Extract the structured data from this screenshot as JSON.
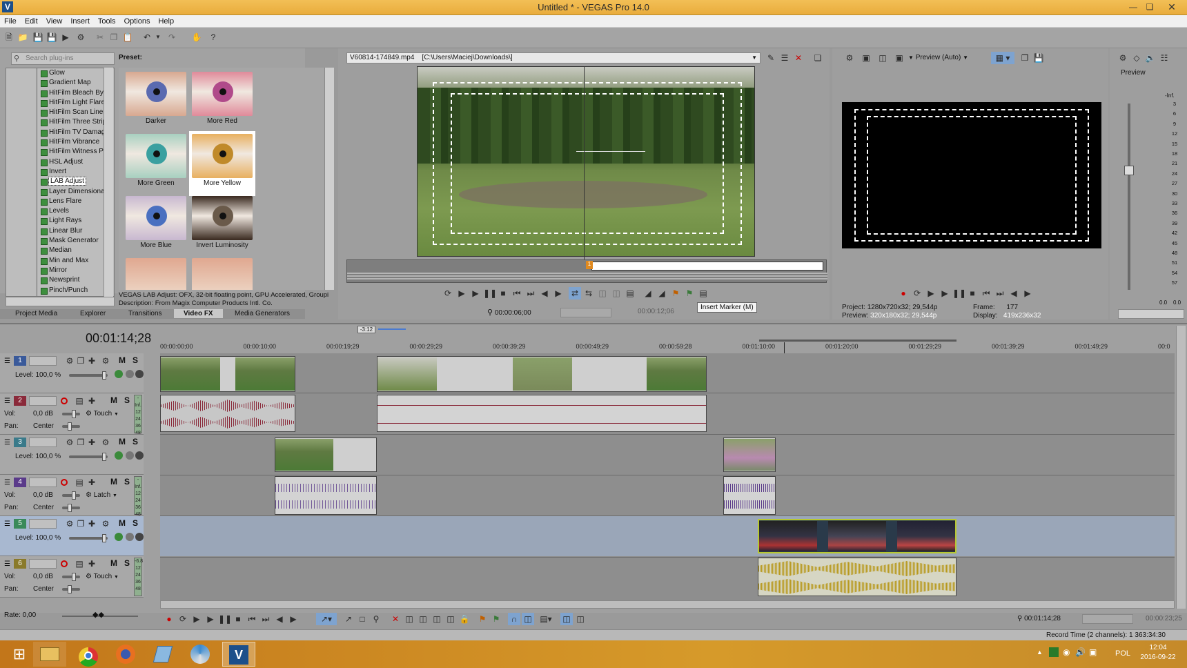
{
  "window": {
    "title": "Untitled * - VEGAS Pro 14.0"
  },
  "menu": [
    "File",
    "Edit",
    "View",
    "Insert",
    "Tools",
    "Options",
    "Help"
  ],
  "plugins": {
    "search_placeholder": "Search plug-ins",
    "items": [
      "Glow",
      "Gradient Map",
      "HitFilm Bleach Byp",
      "HitFilm Light Flares",
      "HitFilm Scan Lines",
      "HitFilm Three Strip",
      "HitFilm TV Damage",
      "HitFilm Vibrance",
      "HitFilm Witness Pr",
      "HSL Adjust",
      "Invert",
      "LAB Adjust",
      "Layer Dimensional",
      "Lens Flare",
      "Levels",
      "Light Rays",
      "Linear Blur",
      "Mask Generator",
      "Median",
      "Min and Max",
      "Mirror",
      "Newsprint",
      "Pinch/Punch"
    ],
    "selected": "LAB Adjust"
  },
  "preset": {
    "label": "Preset:",
    "items": [
      "Darker",
      "More Red",
      "More Green",
      "More Yellow",
      "More Blue",
      "Invert Luminosity"
    ],
    "selected": "More Yellow",
    "description_line1": "VEGAS LAB Adjust: OFX, 32-bit floating point, GPU Accelerated, Groupi",
    "description_line2": "Description: From Magix Computer Products Intl. Co."
  },
  "window_tabs": [
    "Project Media",
    "Explorer",
    "Transitions",
    "Video FX",
    "Media Generators"
  ],
  "active_window_tab": "Video FX",
  "trimmer": {
    "file": "V60814-174849.mp4",
    "path": "[C:\\Users\\Maciej\\Downloads\\]",
    "time_in": "00:00:06;00",
    "time_out": "00:00:12;06",
    "tooltip": "Insert Marker (M)",
    "marker_flag": "1"
  },
  "preview": {
    "mode": "Preview (Auto)",
    "project_label": "Project:",
    "project_value": "1280x720x32; 29,544p",
    "preview_label": "Preview:",
    "preview_value": "320x180x32; 29,544p",
    "frame_label": "Frame:",
    "frame_value": "177",
    "display_label": "Display:",
    "display_value": "419x236x32"
  },
  "master": {
    "label": "Preview",
    "scale": [
      "-Inf.",
      "3",
      "6",
      "9",
      "12",
      "15",
      "18",
      "21",
      "24",
      "27",
      "30",
      "33",
      "36",
      "39",
      "42",
      "45",
      "48",
      "51",
      "54",
      "57"
    ],
    "bottom": [
      "0.0",
      "0.0"
    ],
    "inf_left": "-Inf.",
    "inf_right": "-Inf."
  },
  "timeline": {
    "current_time": "00:01:14;28",
    "zoom": "-3:12",
    "ruler": [
      "00:00:00;00",
      "00:00:10;00",
      "00:00:19;29",
      "00:00:29;29",
      "00:00:39;29",
      "00:00:49;29",
      "00:00:59;28",
      "00:01:10;00",
      "00:01:20;00",
      "00:01:29;29",
      "00:01:39;29",
      "00:01:49;29",
      "00:0"
    ],
    "rate": "Rate: 0,00",
    "time_bottom": "00:01:14;28",
    "time_bottom2": "00:00:23;25",
    "record_time": "Record Time (2 channels): 1 363:34:30"
  },
  "tracks": [
    {
      "num": "1",
      "type": "video",
      "level": "Level: 100,0 %",
      "color": "#3a5a9a"
    },
    {
      "num": "2",
      "type": "audio",
      "vol": "Vol:",
      "vol_value": "0,0 dB",
      "pan": "Pan:",
      "pan_value": "Center",
      "mode": "Touch",
      "color": "#8a2a3a",
      "meter": [
        "-Inf.",
        "12",
        "24",
        "36",
        "48"
      ]
    },
    {
      "num": "3",
      "type": "video",
      "level": "Level: 100,0 %",
      "color": "#3a7a8a"
    },
    {
      "num": "4",
      "type": "audio",
      "vol": "Vol:",
      "vol_value": "0,0 dB",
      "pan": "Pan:",
      "pan_value": "Center",
      "mode": "Latch",
      "color": "#5a3a8a",
      "meter": [
        "-Inf.",
        "12",
        "24",
        "36",
        "48"
      ]
    },
    {
      "num": "5",
      "type": "video",
      "level": "Level: 100,0 %",
      "color": "#3a8a5a"
    },
    {
      "num": "6",
      "type": "audio",
      "vol": "Vol:",
      "vol_value": "0,0 dB",
      "pan": "Pan:",
      "pan_value": "Center",
      "mode": "Touch",
      "color": "#8a7a2a",
      "meter": [
        "-6.8",
        "12",
        "24",
        "36",
        "48"
      ]
    }
  ],
  "track_buttons": {
    "mute": "M",
    "solo": "S"
  },
  "taskbar": {
    "lang": "POL",
    "time": "12:04",
    "date": "2016-09-22"
  }
}
